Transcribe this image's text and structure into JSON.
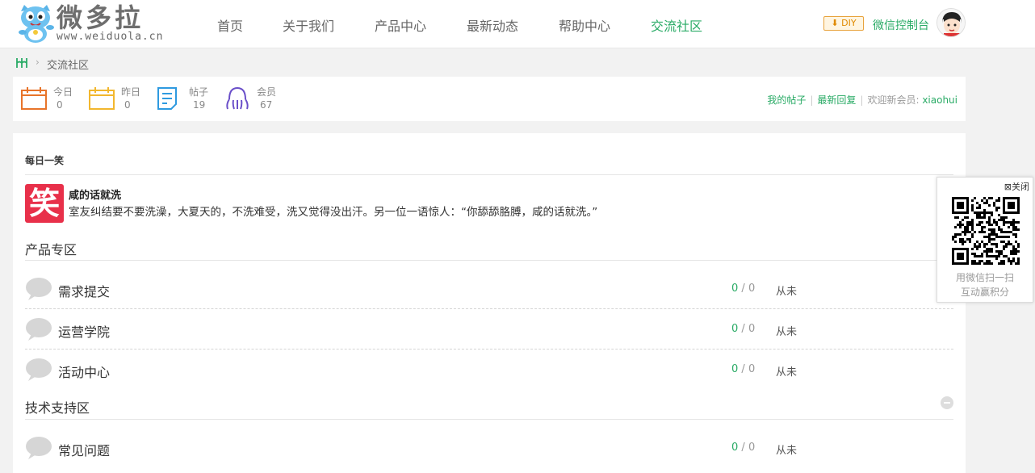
{
  "header": {
    "logo_title": "微多拉",
    "logo_url": "www.weiduola.cn",
    "nav": [
      "首页",
      "关于我们",
      "产品中心",
      "最新动态",
      "帮助中心",
      "交流社区"
    ],
    "active_nav": "交流社区",
    "diy_label": "DIY",
    "console_label": "微信控制台"
  },
  "breadcrumb": {
    "current": "交流社区"
  },
  "stats": {
    "today_label": "今日",
    "today_value": "0",
    "yesterday_label": "昨日",
    "yesterday_value": "0",
    "posts_label": "帖子",
    "posts_value": "19",
    "members_label": "会员",
    "members_value": "67",
    "my_posts": "我的帖子",
    "latest_replies": "最新回复",
    "welcome_prefix": "欢迎新会员:",
    "new_member": "xiaohui"
  },
  "joke": {
    "heading": "每日一笑",
    "icon_char": "笑",
    "title": "咸的话就洗",
    "text": "室友纠结要不要洗澡，大夏天的，不洗难受，洗又觉得没出汗。另一位一语惊人：“你舔舔胳膊，咸的话就洗。”"
  },
  "sections": [
    {
      "title": "产品专区",
      "forums": [
        {
          "name": "需求提交",
          "threads": "0",
          "posts": "0",
          "last": "从未"
        },
        {
          "name": "运营学院",
          "threads": "0",
          "posts": "0",
          "last": "从未"
        },
        {
          "name": "活动中心",
          "threads": "0",
          "posts": "0",
          "last": "从未"
        }
      ]
    },
    {
      "title": "技术支持区",
      "forums": [
        {
          "name": "常见问题",
          "threads": "0",
          "posts": "0",
          "last": "从未"
        }
      ]
    }
  ],
  "qr": {
    "close_label": "关闭",
    "caption1": "用微信扫一扫",
    "caption2": "互动赢积分"
  },
  "colors": {
    "accent_green": "#2aab66",
    "joke_red": "#e8304a",
    "diy_orange": "#e08a00"
  }
}
